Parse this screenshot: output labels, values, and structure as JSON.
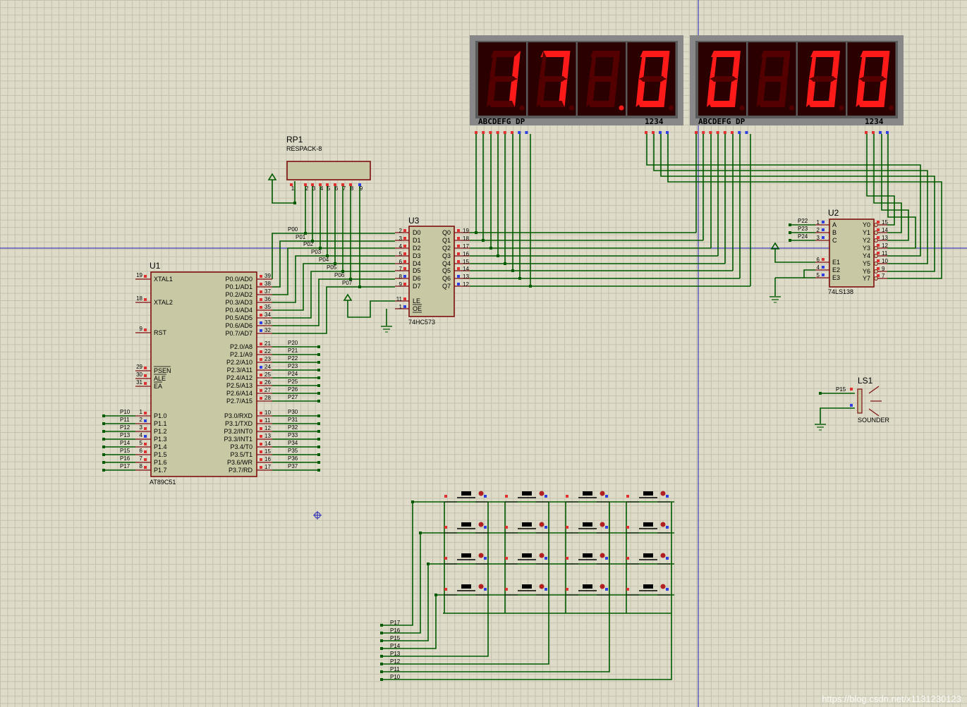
{
  "components": {
    "u1": {
      "ref": "U1",
      "part": "AT89C51",
      "left_pins": [
        {
          "num": "19",
          "name": "XTAL1"
        },
        {
          "num": "18",
          "name": "XTAL2"
        },
        {
          "num": "9",
          "name": "RST"
        },
        {
          "num": "29",
          "name": "PSEN"
        },
        {
          "num": "30",
          "name": "ALE"
        },
        {
          "num": "31",
          "name": "EA"
        },
        {
          "num": "1",
          "name": "P1.0",
          "net": "P10"
        },
        {
          "num": "2",
          "name": "P1.1",
          "net": "P11"
        },
        {
          "num": "3",
          "name": "P1.2",
          "net": "P12"
        },
        {
          "num": "4",
          "name": "P1.3",
          "net": "P13"
        },
        {
          "num": "5",
          "name": "P1.4",
          "net": "P14"
        },
        {
          "num": "6",
          "name": "P1.5",
          "net": "P15"
        },
        {
          "num": "7",
          "name": "P1.6",
          "net": "P16"
        },
        {
          "num": "8",
          "name": "P1.7",
          "net": "P17"
        }
      ],
      "right_pins": [
        {
          "num": "39",
          "name": "P0.0/AD0",
          "net": "P00"
        },
        {
          "num": "38",
          "name": "P0.1/AD1",
          "net": "P01"
        },
        {
          "num": "37",
          "name": "P0.2/AD2",
          "net": "P02"
        },
        {
          "num": "36",
          "name": "P0.3/AD3",
          "net": "P03"
        },
        {
          "num": "35",
          "name": "P0.4/AD4",
          "net": "P04"
        },
        {
          "num": "34",
          "name": "P0.5/AD5",
          "net": "P05"
        },
        {
          "num": "33",
          "name": "P0.6/AD6",
          "net": "P06"
        },
        {
          "num": "32",
          "name": "P0.7/AD7",
          "net": "P07"
        },
        {
          "num": "21",
          "name": "P2.0/A8",
          "net": "P20"
        },
        {
          "num": "22",
          "name": "P2.1/A9",
          "net": "P21"
        },
        {
          "num": "23",
          "name": "P2.2/A10",
          "net": "P22"
        },
        {
          "num": "24",
          "name": "P2.3/A11",
          "net": "P23"
        },
        {
          "num": "25",
          "name": "P2.4/A12",
          "net": "P24"
        },
        {
          "num": "26",
          "name": "P2.5/A13",
          "net": "P25"
        },
        {
          "num": "27",
          "name": "P2.6/A14",
          "net": "P26"
        },
        {
          "num": "28",
          "name": "P2.7/A15",
          "net": "P27"
        },
        {
          "num": "10",
          "name": "P3.0/RXD",
          "net": "P30"
        },
        {
          "num": "11",
          "name": "P3.1/TXD",
          "net": "P31"
        },
        {
          "num": "12",
          "name": "P3.2/INT0",
          "net": "P32"
        },
        {
          "num": "13",
          "name": "P3.3/INT1",
          "net": "P33"
        },
        {
          "num": "14",
          "name": "P3.4/T0",
          "net": "P34"
        },
        {
          "num": "15",
          "name": "P3.5/T1",
          "net": "P35"
        },
        {
          "num": "16",
          "name": "P3.6/WR",
          "net": "P36"
        },
        {
          "num": "17",
          "name": "P3.7/RD",
          "net": "P37"
        }
      ]
    },
    "u3": {
      "ref": "U3",
      "part": "74HC573",
      "inputs": [
        {
          "num": "2",
          "name": "D0",
          "net": "P00"
        },
        {
          "num": "3",
          "name": "D1",
          "net": "P01"
        },
        {
          "num": "4",
          "name": "D2",
          "net": "P02"
        },
        {
          "num": "5",
          "name": "D3",
          "net": "P03"
        },
        {
          "num": "6",
          "name": "D4",
          "net": "P04"
        },
        {
          "num": "7",
          "name": "D5",
          "net": "P05"
        },
        {
          "num": "8",
          "name": "D6",
          "net": "P06"
        },
        {
          "num": "9",
          "name": "D7",
          "net": "P07"
        }
      ],
      "controls": [
        {
          "num": "11",
          "name": "LE"
        },
        {
          "num": "1",
          "name": "OE"
        }
      ],
      "outputs": [
        {
          "num": "19",
          "name": "Q0"
        },
        {
          "num": "18",
          "name": "Q1"
        },
        {
          "num": "17",
          "name": "Q2"
        },
        {
          "num": "16",
          "name": "Q3"
        },
        {
          "num": "15",
          "name": "Q4"
        },
        {
          "num": "14",
          "name": "Q5"
        },
        {
          "num": "13",
          "name": "Q6"
        },
        {
          "num": "12",
          "name": "Q7"
        }
      ]
    },
    "u2": {
      "ref": "U2",
      "part": "74LS138",
      "inputs": [
        {
          "num": "1",
          "name": "A",
          "net": "P22"
        },
        {
          "num": "2",
          "name": "B",
          "net": "P23"
        },
        {
          "num": "3",
          "name": "C",
          "net": "P24"
        },
        {
          "num": "6",
          "name": "E1"
        },
        {
          "num": "4",
          "name": "E2"
        },
        {
          "num": "5",
          "name": "E3"
        }
      ],
      "outputs": [
        {
          "num": "15",
          "name": "Y0"
        },
        {
          "num": "14",
          "name": "Y1"
        },
        {
          "num": "13",
          "name": "Y2"
        },
        {
          "num": "12",
          "name": "Y3"
        },
        {
          "num": "11",
          "name": "Y4"
        },
        {
          "num": "10",
          "name": "Y5"
        },
        {
          "num": "9",
          "name": "Y6"
        },
        {
          "num": "7",
          "name": "Y7"
        }
      ]
    },
    "rp1": {
      "ref": "RP1",
      "part": "RESPACK-8",
      "pins": [
        "1",
        "2",
        "3",
        "4",
        "5",
        "6",
        "7",
        "8",
        "9"
      ]
    },
    "ls1": {
      "ref": "LS1",
      "part": "SOUNDER",
      "net": "P15"
    },
    "display_left": {
      "segments_label": "ABCDEFG DP",
      "commons_label": "1234",
      "digits": [
        "1",
        "7",
        "",
        "0"
      ],
      "dots_lit": [
        false,
        false,
        true,
        false
      ]
    },
    "display_right": {
      "segments_label": "ABCDEFG DP",
      "commons_label": "1234",
      "digits": [
        "0",
        "",
        "0",
        "0"
      ],
      "dots_lit": [
        false,
        false,
        false,
        false
      ]
    },
    "keypad": {
      "rows": 4,
      "cols": 4,
      "nets": [
        "P17",
        "P16",
        "P15",
        "P14",
        "P13",
        "P12",
        "P11",
        "P10"
      ]
    }
  },
  "watermark": "https://blog.csdn.net/x1131230123",
  "colors": {
    "wire": "#005a00",
    "component_border": "#7d0e0e",
    "component_fill": "#c9c8a4",
    "segment_on": "#ff1a1a",
    "segment_off": "#540000",
    "display_bg": "#2a0000",
    "display_frame": "#888888",
    "pin_red": "#e03030",
    "pin_blue": "#3040e0"
  }
}
